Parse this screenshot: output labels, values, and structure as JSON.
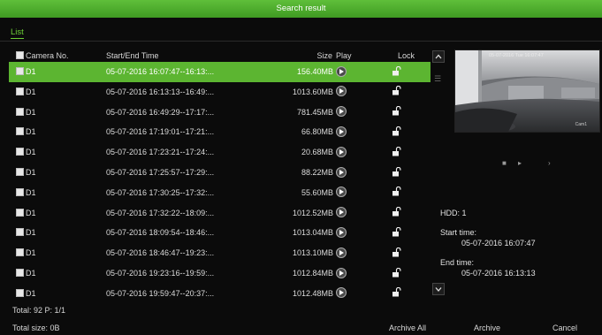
{
  "window": {
    "title": "Search result"
  },
  "tabs": [
    {
      "label": "List"
    }
  ],
  "table": {
    "headers": {
      "camera": "Camera No.",
      "time": "Start/End Time",
      "size": "Size",
      "play": "Play",
      "lock": "Lock"
    },
    "rows": [
      {
        "camera": "D1",
        "time": "05-07-2016 16:07:47--16:13:...",
        "size": "156.40MB"
      },
      {
        "camera": "D1",
        "time": "05-07-2016 16:13:13--16:49:...",
        "size": "1013.60MB"
      },
      {
        "camera": "D1",
        "time": "05-07-2016 16:49:29--17:17:...",
        "size": "781.45MB"
      },
      {
        "camera": "D1",
        "time": "05-07-2016 17:19:01--17:21:...",
        "size": "66.80MB"
      },
      {
        "camera": "D1",
        "time": "05-07-2016 17:23:21--17:24:...",
        "size": "20.68MB"
      },
      {
        "camera": "D1",
        "time": "05-07-2016 17:25:57--17:29:...",
        "size": "88.22MB"
      },
      {
        "camera": "D1",
        "time": "05-07-2016 17:30:25--17:32:...",
        "size": "55.60MB"
      },
      {
        "camera": "D1",
        "time": "05-07-2016 17:32:22--18:09:...",
        "size": "1012.52MB"
      },
      {
        "camera": "D1",
        "time": "05-07-2016 18:09:54--18:46:...",
        "size": "1013.04MB"
      },
      {
        "camera": "D1",
        "time": "05-07-2016 18:46:47--19:23:...",
        "size": "1013.10MB"
      },
      {
        "camera": "D1",
        "time": "05-07-2016 19:23:16--19:59:...",
        "size": "1012.84MB"
      },
      {
        "camera": "D1",
        "time": "05-07-2016 19:59:47--20:37:...",
        "size": "1012.48MB"
      }
    ],
    "selected_index": 0
  },
  "preview": {
    "timestamp": "05-07-2016 Tue 16:07:47",
    "camera_name": "Cam1"
  },
  "details": {
    "hdd": "HDD: 1",
    "start_label": "Start time:",
    "start_value": "05-07-2016 16:07:47",
    "end_label": "End time:",
    "end_value": "05-07-2016 16:13:13"
  },
  "footer": {
    "total": "Total: 92  P: 1/1",
    "total_size": "Total size: 0B",
    "archive_all": "Archive All",
    "archive": "Archive",
    "cancel": "Cancel"
  },
  "colors": {
    "accent": "#5cb531",
    "background": "#0b0b0b",
    "text": "#e6e6e6"
  },
  "icons": {
    "play": "play-circle-icon",
    "lock": "unlock-icon",
    "scroll_up": "chevron-up-icon",
    "scroll_down": "chevron-down-icon",
    "playback_stop": "stop-icon",
    "playback_play": "play-icon",
    "playback_next": "chevron-right-icon"
  }
}
